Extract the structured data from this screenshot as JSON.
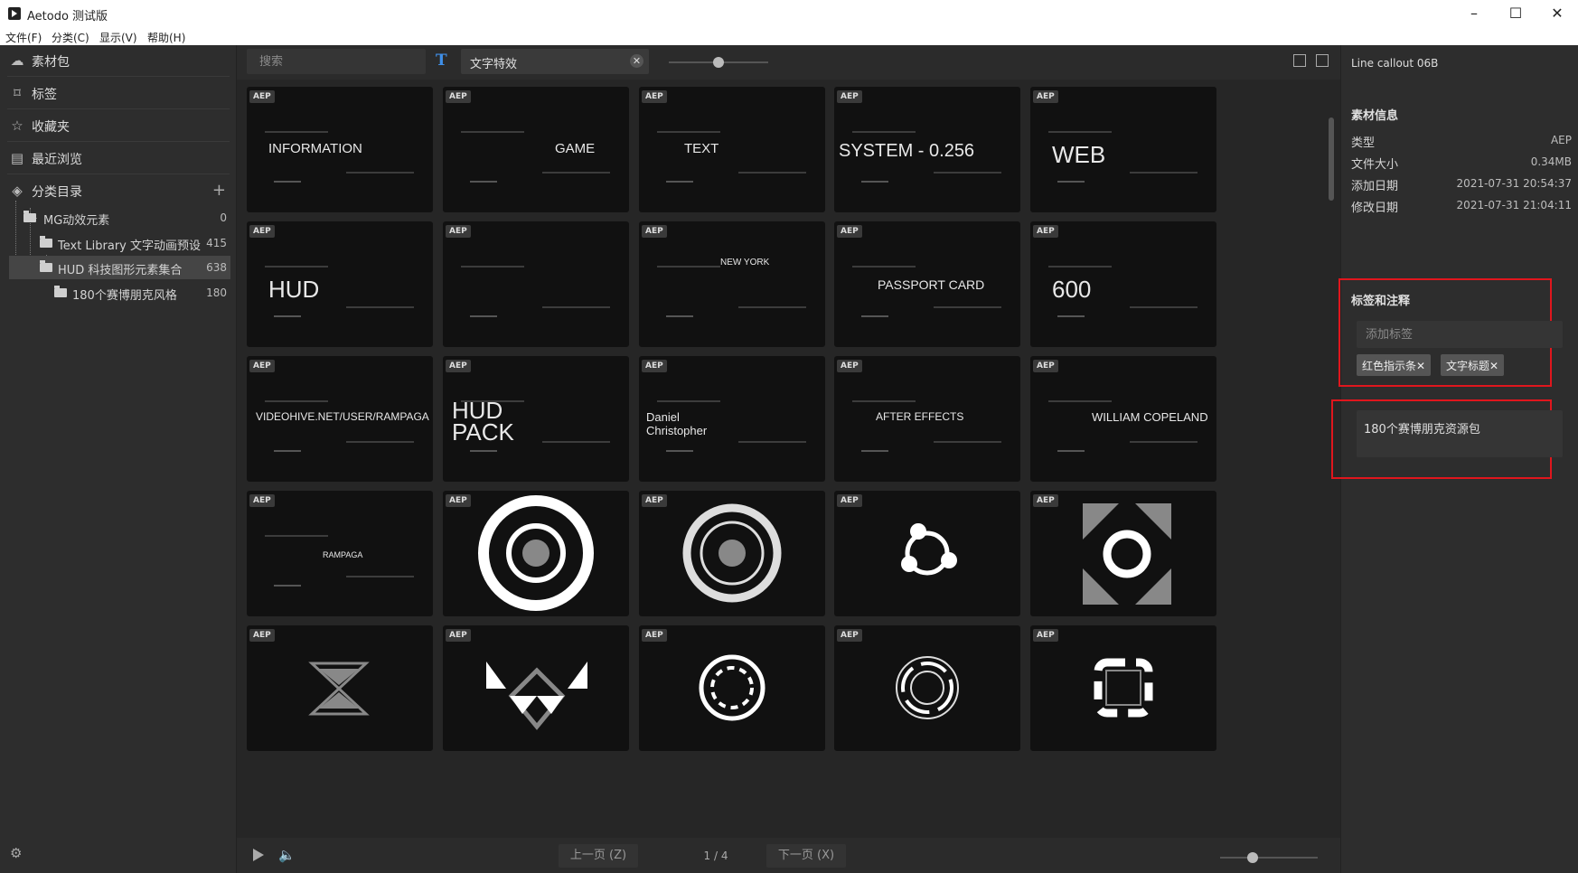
{
  "app": {
    "title": "Aetodo 测试版"
  },
  "window_controls": {
    "minimize": "–",
    "maximize": "☐",
    "close": "✕"
  },
  "menu": [
    "文件(F)",
    "分类(C)",
    "显示(V)",
    "帮助(H)"
  ],
  "sidebar": {
    "nav": [
      {
        "label": "素材包",
        "icon": "cloud-icon"
      },
      {
        "label": "标签",
        "icon": "tag-icon"
      },
      {
        "label": "收藏夹",
        "icon": "star-icon"
      },
      {
        "label": "最近浏览",
        "icon": "history-icon"
      },
      {
        "label": "分类目录",
        "icon": "layers-icon"
      }
    ],
    "add_symbol": "+",
    "tree": [
      {
        "label": "MG动效元素",
        "count": "0"
      },
      {
        "label": "Text Library 文字动画预设",
        "count": "415"
      },
      {
        "label": "HUD 科技图形元素集合",
        "count": "638"
      },
      {
        "label": "180个赛博朋克风格",
        "count": "180"
      }
    ],
    "settings_icon": "gear-icon"
  },
  "topbar": {
    "search_placeholder": "搜索",
    "type_symbol": "T",
    "active_tag": "文字特效",
    "tag_close": "✕",
    "zoom_level": 0.5
  },
  "grid": {
    "badge": "AEP",
    "items": [
      {
        "caption": "INFORMATION"
      },
      {
        "caption": "GAME"
      },
      {
        "caption": "TEXT"
      },
      {
        "caption": "SYSTEM -  0.256"
      },
      {
        "caption": "WEB"
      },
      {
        "caption": "HUD"
      },
      {
        "caption": ""
      },
      {
        "caption": "NEW YORK"
      },
      {
        "caption": "PASSPORT CARD"
      },
      {
        "caption": "600"
      },
      {
        "caption": "VIDEOHIVE.NET/USER/RAMPAGA"
      },
      {
        "caption": "HUD PACK"
      },
      {
        "caption": "Daniel Christopher"
      },
      {
        "caption": "AFTER EFFECTS"
      },
      {
        "caption": "WILLIAM    COPELAND"
      },
      {
        "caption": "RAMPAGA"
      },
      {
        "caption": ""
      },
      {
        "caption": ""
      },
      {
        "caption": ""
      },
      {
        "caption": ""
      },
      {
        "caption": ""
      },
      {
        "caption": ""
      },
      {
        "caption": ""
      },
      {
        "caption": ""
      },
      {
        "caption": ""
      }
    ]
  },
  "pagination": {
    "prev": "上一页 (Z)",
    "page": "1 / 4",
    "next": "下一页 (X)"
  },
  "detail": {
    "item_name": "Line callout 06B",
    "info_heading": "素材信息",
    "info": [
      {
        "key": "类型",
        "value": "AEP"
      },
      {
        "key": "文件大小",
        "value": "0.34MB"
      },
      {
        "key": "添加日期",
        "value": "2021-07-31 20:54:37"
      },
      {
        "key": "修改日期",
        "value": "2021-07-31 21:04:11"
      }
    ],
    "tags_heading": "标签和注释",
    "tag_placeholder": "添加标签",
    "tags": [
      "红色指示条✕",
      "文字标题✕"
    ],
    "note": "180个赛博朋克资源包"
  },
  "colors": {
    "accent": "#3f8fe8",
    "highlight": "#e0161d"
  }
}
